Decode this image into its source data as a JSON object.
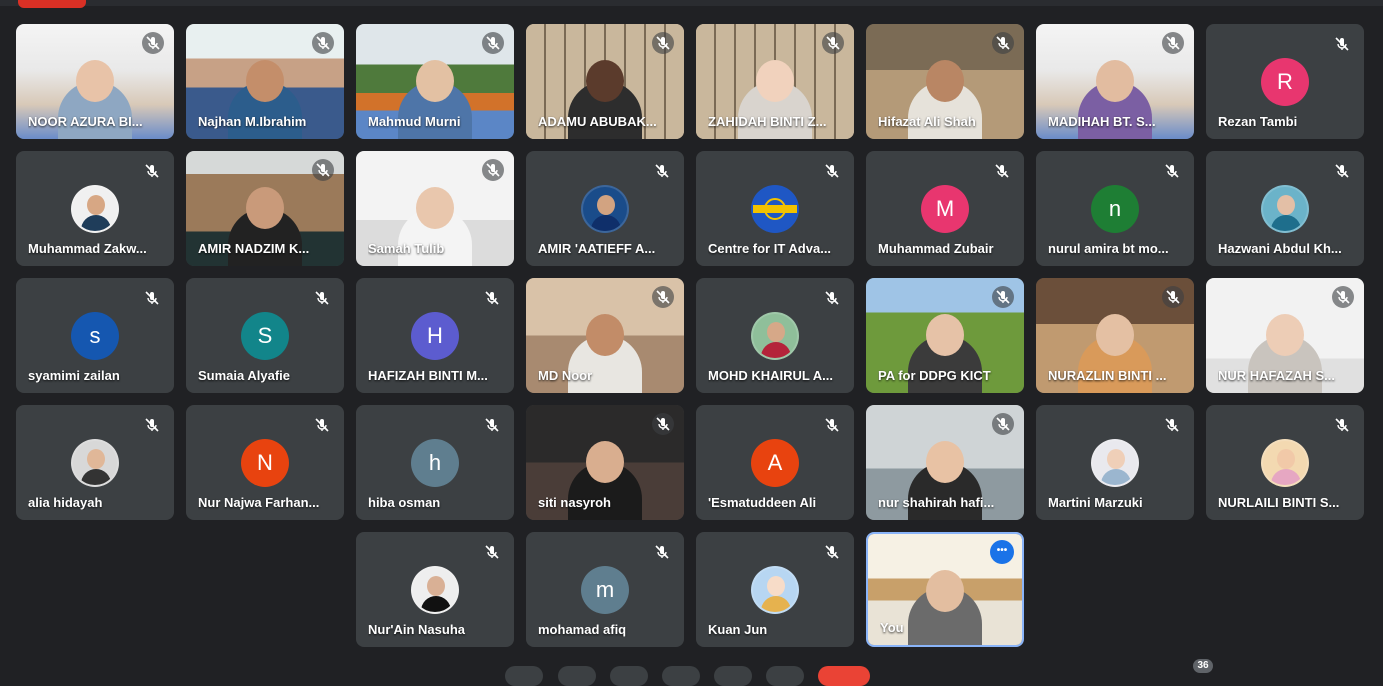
{
  "participant_count": "36",
  "tiles": [
    {
      "id": "t1",
      "name": "NOOR AZURA BI...",
      "type": "video",
      "scene": "scene-banner",
      "skin": "#e8c3a8",
      "body": "#8ea7c2"
    },
    {
      "id": "t2",
      "name": "Najhan M.Ibrahim",
      "type": "video",
      "scene": "scene-campus",
      "skin": "#c48e6a",
      "body": "#2c5d8c"
    },
    {
      "id": "t3",
      "name": "Mahmud Murni",
      "type": "video",
      "scene": "scene-garden",
      "skin": "#e3c1a3",
      "body": "#4e75a8"
    },
    {
      "id": "t4",
      "name": "ADAMU ABUBAK...",
      "type": "video",
      "scene": "scene-shelf",
      "skin": "#5b3b2c",
      "body": "#2d2d2d"
    },
    {
      "id": "t5",
      "name": "ZAHIDAH BINTI Z...",
      "type": "video",
      "scene": "scene-shelf",
      "skin": "#f1d2bd",
      "body": "#d9d4ce"
    },
    {
      "id": "t6",
      "name": "Hifazat Ali Shah",
      "type": "video",
      "scene": "scene-office",
      "skin": "#b98664",
      "body": "#e6e2da"
    },
    {
      "id": "t7",
      "name": "MADIHAH BT. S...",
      "type": "video",
      "scene": "scene-banner",
      "skin": "#e2bca0",
      "body": "#7b5fa3"
    },
    {
      "id": "t8",
      "name": "Rezan Tambi",
      "type": "letter",
      "letter": "R",
      "color": "#e8366f"
    },
    {
      "id": "t9",
      "name": "Muhammad Zakw...",
      "type": "photo",
      "color": "#f0f0f0",
      "skin": "#d7a784",
      "body": "#1f3d5a"
    },
    {
      "id": "t10",
      "name": "AMIR NADZIM K...",
      "type": "video",
      "scene": "scene-building",
      "skin": "#c99a7a",
      "body": "#222"
    },
    {
      "id": "t11",
      "name": "Samah Tulib",
      "type": "video",
      "scene": "scene-room",
      "skin": "#e9c7ad",
      "body": "#f4f4f4"
    },
    {
      "id": "t12",
      "name": "AMIR 'AATIEFF A...",
      "type": "photo",
      "color": "#1a4c8a",
      "skin": "#d2a381",
      "body": "#0f2f6a"
    },
    {
      "id": "t13",
      "name": "Centre for IT Adva...",
      "type": "logo",
      "color": "#1f57c4"
    },
    {
      "id": "t14",
      "name": "Muhammad Zubair",
      "type": "letter",
      "letter": "M",
      "color": "#e8366f"
    },
    {
      "id": "t15",
      "name": "nurul amira bt mo...",
      "type": "letter",
      "letter": "n",
      "color": "#1e7e34"
    },
    {
      "id": "t16",
      "name": "Hazwani Abdul Kh...",
      "type": "photo",
      "color": "#6bb3c9",
      "skin": "#e3bfa6",
      "body": "#1e6e8c"
    },
    {
      "id": "t17",
      "name": "syamimi zailan",
      "type": "letter",
      "letter": "s",
      "color": "#1557b0"
    },
    {
      "id": "t18",
      "name": "Sumaia Alyafie",
      "type": "letter",
      "letter": "S",
      "color": "#12858a"
    },
    {
      "id": "t19",
      "name": "HAFIZAH BINTI M...",
      "type": "letter",
      "letter": "H",
      "color": "#5c5ccf"
    },
    {
      "id": "t20",
      "name": "MD Noor",
      "type": "video",
      "scene": "scene-warm",
      "skin": "#c28c68",
      "body": "#e8e6e1"
    },
    {
      "id": "t21",
      "name": "MOHD KHAIRUL A...",
      "type": "photo",
      "color": "#8fbf9a",
      "skin": "#d6a888",
      "body": "#b4243a"
    },
    {
      "id": "t22",
      "name": "PA for DDPG KICT",
      "type": "video",
      "scene": "scene-field",
      "skin": "#e6c2a7",
      "body": "#3b3b3b"
    },
    {
      "id": "t23",
      "name": "NURAZLIN BINTI ...",
      "type": "video",
      "scene": "scene-lamp",
      "skin": "#e4c0a3",
      "body": "#d99a5a"
    },
    {
      "id": "t24",
      "name": "NUR HAFAZAH S...",
      "type": "video",
      "scene": "scene-white",
      "skin": "#edcdb6",
      "body": "#c9c4be"
    },
    {
      "id": "t25",
      "name": "alia hidayah",
      "type": "photo",
      "color": "#d8d8d8",
      "skin": "#e0b798",
      "body": "#333"
    },
    {
      "id": "t26",
      "name": "Nur Najwa Farhan...",
      "type": "letter",
      "letter": "N",
      "color": "#e8430f"
    },
    {
      "id": "t27",
      "name": "hiba osman",
      "type": "letter",
      "letter": "h",
      "color": "#5f7e8f"
    },
    {
      "id": "t28",
      "name": "siti nasyroh",
      "type": "video",
      "scene": "scene-dark",
      "skin": "#d9ae8f",
      "body": "#1b1b1b"
    },
    {
      "id": "t29",
      "name": "'Esmatuddeen Ali",
      "type": "letter",
      "letter": "A",
      "color": "#e8430f"
    },
    {
      "id": "t30",
      "name": "nur shahirah hafi...",
      "type": "video",
      "scene": "scene-cafe",
      "skin": "#e8c2a4",
      "body": "#2a2a2a"
    },
    {
      "id": "t31",
      "name": "Martini Marzuki",
      "type": "photo",
      "color": "#e9e9ee",
      "skin": "#efcfb8",
      "body": "#9bb6cf"
    },
    {
      "id": "t32",
      "name": "NURLAILI BINTI S...",
      "type": "photo",
      "color": "#f3d9b1",
      "skin": "#f1c9a8",
      "body": "#e6a7c2"
    },
    {
      "id": "t33",
      "name": "Nur'Ain Nasuha",
      "type": "photo",
      "color": "#eeeeee",
      "skin": "#d9b095",
      "body": "#111"
    },
    {
      "id": "t34",
      "name": "mohamad afiq",
      "type": "letter",
      "letter": "m",
      "color": "#5f7e8f"
    },
    {
      "id": "t35",
      "name": "Kuan Jun",
      "type": "photo",
      "color": "#b7d6f2",
      "skin": "#f7dcc8",
      "body": "#e6b24e"
    },
    {
      "id": "t36",
      "name": "You",
      "type": "video",
      "scene": "scene-home",
      "skin": "#e3bea0",
      "body": "#6b6b6b",
      "self": true
    }
  ]
}
